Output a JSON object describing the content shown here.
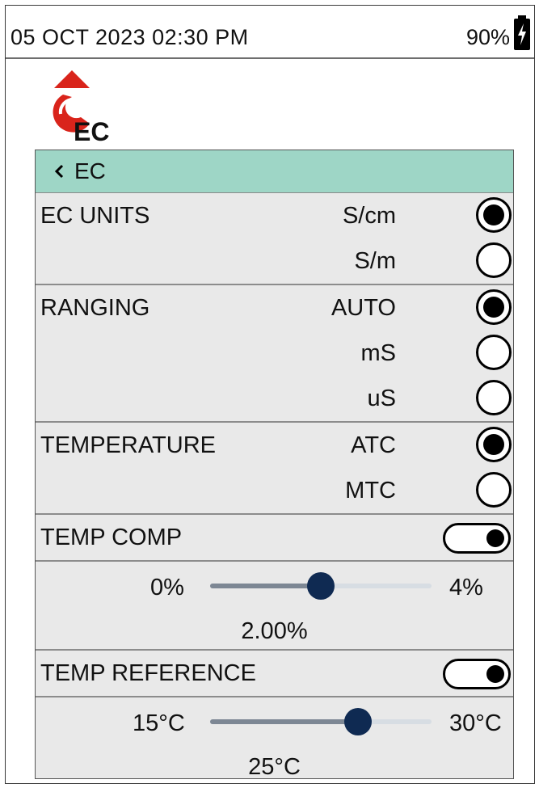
{
  "status": {
    "datetime": "05 OCT 2023 02:30 PM",
    "battery": "90%",
    "battery_icon": "battery-charging-icon"
  },
  "logo": {
    "text": "EC",
    "accent": "#d9241b"
  },
  "header": {
    "back_icon": "chevron-left-icon",
    "title": "EC"
  },
  "ec_units": {
    "label": "EC UNITS",
    "options": [
      {
        "label": "S/cm",
        "selected": true
      },
      {
        "label": "S/m",
        "selected": false
      }
    ]
  },
  "ranging": {
    "label": "RANGING",
    "options": [
      {
        "label": "AUTO",
        "selected": true
      },
      {
        "label": "mS",
        "selected": false
      },
      {
        "label": "uS",
        "selected": false
      }
    ]
  },
  "temperature": {
    "label": "TEMPERATURE",
    "options": [
      {
        "label": "ATC",
        "selected": true
      },
      {
        "label": "MTC",
        "selected": false
      }
    ]
  },
  "temp_comp": {
    "label": "TEMP COMP",
    "enabled": true,
    "min": "0%",
    "max": "4%",
    "value": 2.0,
    "value_text": "2.00%"
  },
  "temp_reference": {
    "label": "TEMP REFERENCE",
    "enabled": true,
    "min": "15°C",
    "max": "30°C",
    "value": 25,
    "value_text": "25°C"
  },
  "colors": {
    "header_bg": "#9ed6c6",
    "panel_bg": "#e9e9e9",
    "slider_thumb": "#0f2a52"
  }
}
